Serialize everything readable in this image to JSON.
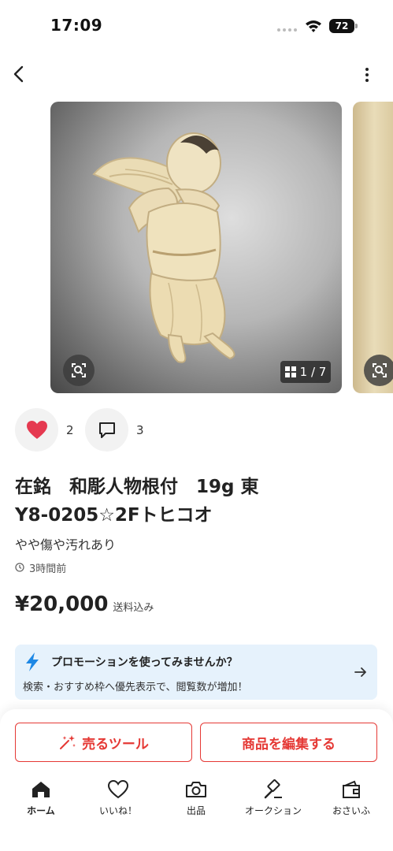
{
  "status_bar": {
    "time": "17:09",
    "battery": "72"
  },
  "gallery": {
    "counter": "1 / 7"
  },
  "reactions": {
    "likes": "2",
    "comments": "3"
  },
  "item": {
    "title": "在銘　和彫人物根付　19g 東\nY8-0205☆2Fトヒコオ",
    "condition": "やや傷や汚れあり",
    "posted": "3時間前",
    "price": "¥20,000",
    "shipping": "送料込み"
  },
  "promo": {
    "title": "プロモーションを使ってみませんか？",
    "description": "検索・おすすめ枠へ優先表示で、閲覧数が増加！"
  },
  "actions": {
    "sell_tool": "売るツール",
    "edit_item": "商品を編集する"
  },
  "tabs": [
    {
      "label": "ホーム",
      "icon": "home-icon"
    },
    {
      "label": "いいね！",
      "icon": "heart-icon"
    },
    {
      "label": "出品",
      "icon": "camera-icon"
    },
    {
      "label": "オークション",
      "icon": "gavel-icon"
    },
    {
      "label": "おさいふ",
      "icon": "wallet-icon"
    }
  ],
  "colors": {
    "accent": "#e53935",
    "like": "#e53950",
    "promo_bg": "#e6f2fc",
    "promo_icon": "#1e88e5"
  }
}
